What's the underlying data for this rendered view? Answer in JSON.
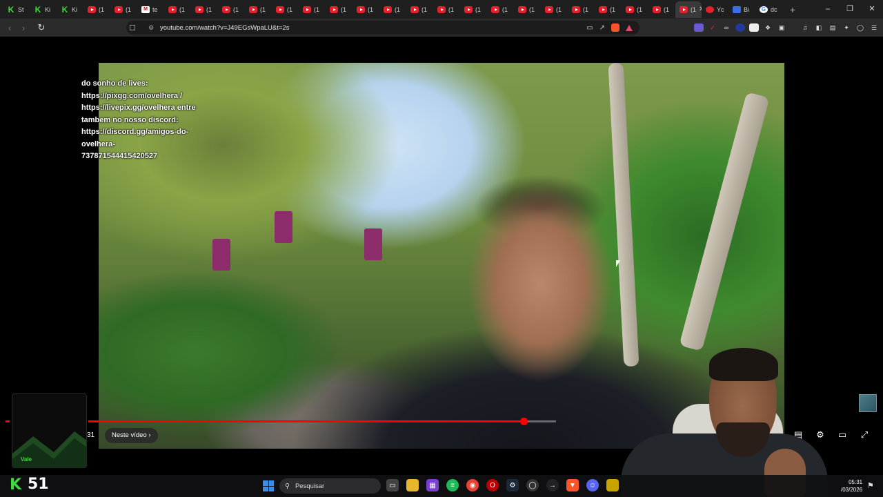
{
  "browser": {
    "tabs": [
      {
        "icon": "kick-icon",
        "label": "St"
      },
      {
        "icon": "kick-icon",
        "label": "Ki"
      },
      {
        "icon": "kick-icon",
        "label": "Ki"
      },
      {
        "icon": "youtube-icon",
        "label": "(1"
      },
      {
        "icon": "youtube-icon",
        "label": "(1"
      },
      {
        "icon": "tv-icon",
        "label": "te"
      },
      {
        "icon": "youtube-icon",
        "label": "(1"
      },
      {
        "icon": "youtube-icon",
        "label": "(1"
      },
      {
        "icon": "youtube-icon",
        "label": "(1"
      },
      {
        "icon": "youtube-icon",
        "label": "(1"
      },
      {
        "icon": "youtube-icon",
        "label": "(1"
      },
      {
        "icon": "youtube-icon",
        "label": "(1"
      },
      {
        "icon": "youtube-icon",
        "label": "(1"
      },
      {
        "icon": "youtube-icon",
        "label": "(1"
      },
      {
        "icon": "youtube-icon",
        "label": "(1"
      },
      {
        "icon": "youtube-icon",
        "label": "(1"
      },
      {
        "icon": "youtube-icon",
        "label": "(1"
      },
      {
        "icon": "youtube-icon",
        "label": "(1"
      },
      {
        "icon": "youtube-icon",
        "label": "(1"
      },
      {
        "icon": "youtube-icon",
        "label": "(1"
      },
      {
        "icon": "youtube-icon",
        "label": "(1"
      },
      {
        "icon": "youtube-icon",
        "label": "(1"
      },
      {
        "icon": "youtube-icon",
        "label": "(1"
      },
      {
        "icon": "youtube-icon",
        "label": "(1"
      },
      {
        "icon": "youtube-icon",
        "label": "(1"
      }
    ],
    "active_tab": {
      "label": "(1"
    },
    "extra_tabs": [
      {
        "icon": "opera-icon",
        "label": "Yc"
      },
      {
        "icon": "bluesky-icon",
        "label": "Bi"
      },
      {
        "icon": "google-icon",
        "label": "dc"
      }
    ],
    "new_tab": "+",
    "url": "youtube.com/watch?v=J49EGsWpaLU&t=2s"
  },
  "video": {
    "description": [
      "do sonho de lives:",
      "https://pixgg.com/ovelhera /",
      "https://livepix.gg/ovelhera entre",
      "tambem no nosso discord:",
      "https://discord.gg/amigos-do-",
      "ovelhera-",
      "737871544415420527"
    ],
    "progress": 0.93,
    "time_fragment": "31",
    "chapter_button": "Neste vídeo"
  },
  "stream_overlay": {
    "kick_logo": "K",
    "viewer_count": "51",
    "cam_label": "Vale"
  },
  "taskbar": {
    "search_placeholder": "Pesquisar",
    "time": "05:31",
    "date": "/03/2026"
  },
  "colors": {
    "accent": "#ff0000",
    "kick_green": "#3ddc3d"
  }
}
